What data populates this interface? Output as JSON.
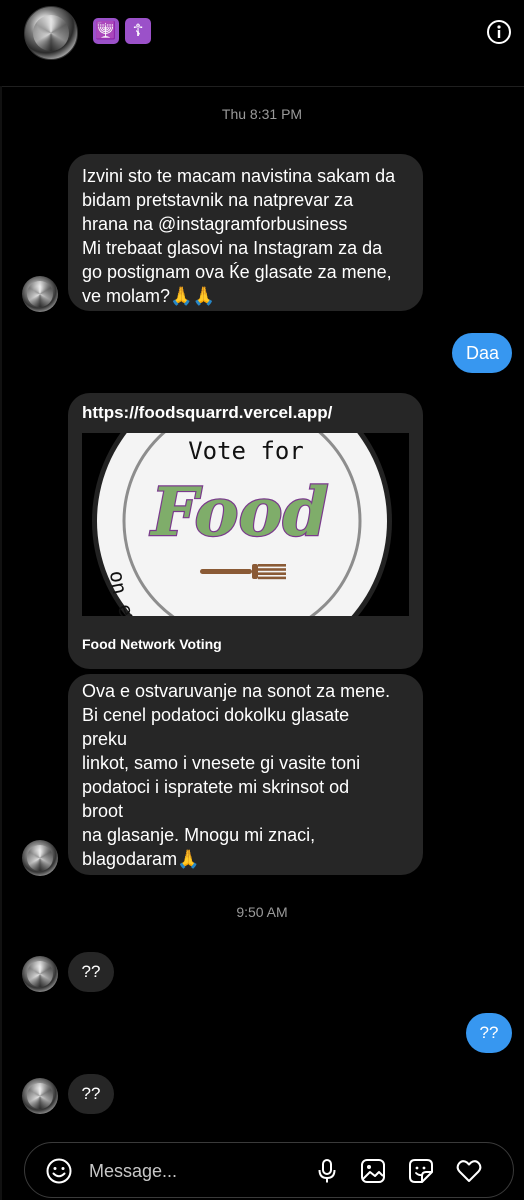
{
  "header": {
    "badges": [
      "🕎",
      "☦"
    ],
    "info_icon": "info-icon"
  },
  "messages": [
    {
      "type": "timestamp",
      "text": "Thu 8:31 PM"
    },
    {
      "type": "incoming",
      "text": "Izvini sto te macam navistina sakam da\nbidam pretstavnik na natprevar za\nhrana na @instagramforbusiness\nMi trebaat glasovi na Instagram za da\ngo postignam ova Ќe glasate za mene,\nve molam?🙏🙏"
    },
    {
      "type": "outgoing",
      "text": "Daa"
    },
    {
      "type": "link",
      "url": "https://foodsquarrd.vercel.app/",
      "preview_top": "Vote for",
      "preview_main": "Food",
      "preview_bottom": "on every plate",
      "title": "Food Network Voting"
    },
    {
      "type": "incoming",
      "text": "Ova e ostvaruvanje na sonot za mene.\nBi cenel podatoci dokolku glasate\npreku\nlinkot, samo i vnesete gi vasite toni\npodatoci i ispratete mi skrinsot od\nbroot\nna glasanje. Mnogu mi znaci,\nblagodaram🙏"
    },
    {
      "type": "timestamp",
      "text": "9:50 AM"
    },
    {
      "type": "incoming",
      "text": "??"
    },
    {
      "type": "outgoing",
      "text": "??"
    },
    {
      "type": "incoming",
      "text": "??"
    }
  ],
  "composer": {
    "placeholder": "Message...",
    "icons": [
      "emoji-icon",
      "microphone-icon",
      "gallery-icon",
      "sticker-icon",
      "heart-icon"
    ]
  },
  "colors": {
    "background": "#000000",
    "incoming_bubble": "#262626",
    "outgoing_bubble": "#3797f0",
    "food_green": "#7fad6a",
    "food_purple": "#7a3a8c"
  }
}
